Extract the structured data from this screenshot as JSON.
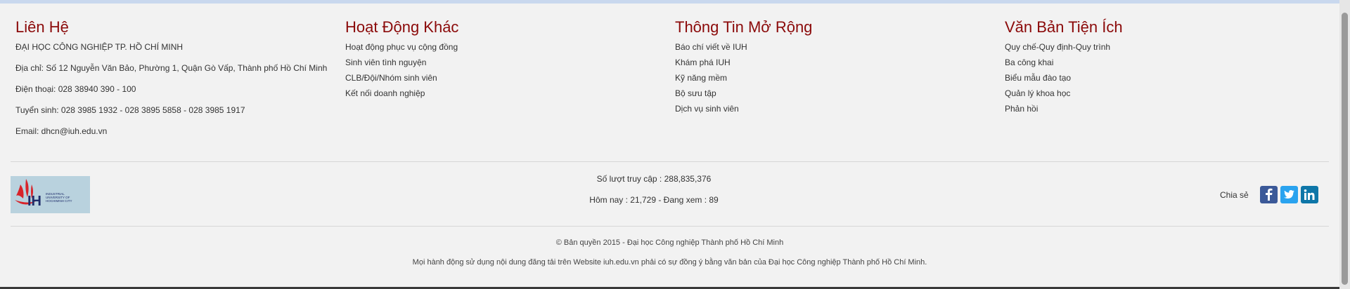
{
  "contact": {
    "title": "Liên Hệ",
    "lines": [
      "ĐẠI HỌC CÔNG NGHIỆP TP. HỒ CHÍ MINH",
      "Địa chỉ: Số 12 Nguyễn Văn Bảo, Phường 1, Quận Gò Vấp, Thành phố Hồ Chí Minh",
      "Điện thoại: 028 38940 390 - 100",
      "Tuyển sinh: 028 3985 1932 - 028 3895 5858 - 028 3985 1917",
      "Email: dhcn@iuh.edu.vn"
    ]
  },
  "activities": {
    "title": "Hoạt Động Khác",
    "items": [
      "Hoạt động phục vụ cộng đồng",
      "Sinh viên tình nguyện",
      "CLB/Đội/Nhóm sinh viên",
      "Kết nối doanh nghiệp"
    ]
  },
  "extended": {
    "title": "Thông Tin Mở Rộng",
    "items": [
      "Báo chí viết về IUH",
      "Khám phá IUH",
      "Kỹ năng mềm",
      "Bộ sưu tập",
      "Dịch vụ sinh viên"
    ]
  },
  "documents": {
    "title": "Văn Bản Tiện Ích",
    "items": [
      "Quy chế-Quy định-Quy trình",
      "Ba công khai",
      "Biểu mẫu đào tạo",
      "Quản lý khoa học",
      "Phản hồi"
    ]
  },
  "logo": {
    "mark": "IH",
    "lines": [
      "INDUSTRIAL",
      "UNIVERSITY OF",
      "HOCHIMINH CITY"
    ]
  },
  "stats": {
    "total": "Số lượt truy cập : 288,835,376",
    "today": "Hôm nay : 21,729 - Đang xem : 89"
  },
  "share": {
    "label": "Chia sẻ",
    "icons": [
      "facebook-icon",
      "twitter-icon",
      "linkedin-icon"
    ],
    "colors": {
      "facebook": "#3b5998",
      "twitter": "#2aa3ef",
      "linkedin": "#0e76a8"
    }
  },
  "copyright": {
    "line1": "© Bản quyền 2015 - Đại học Công nghiệp Thành phố Hồ Chí Minh",
    "line2": "Mọi hành động sử dụng nội dung đăng tải trên Website iuh.edu.vn phải có sự đồng ý bằng văn bản của Đại học Công nghiệp Thành phố Hồ Chí Minh."
  },
  "colors": {
    "heading": "#8b0a0a",
    "background": "#f2f2f2",
    "topbar": "#c9d8ee"
  }
}
